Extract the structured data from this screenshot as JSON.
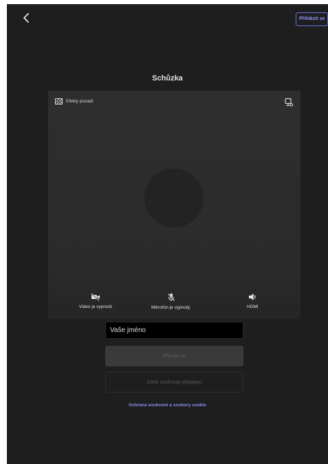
{
  "header": {
    "back_icon": "chevron-left-icon",
    "signin_label": "Přihlásit se"
  },
  "meeting": {
    "title": "Schůzka"
  },
  "preview": {
    "background_effects_label": "Efekty pozadí",
    "background_effects_icon": "background-effects-icon",
    "device_icon": "device-settings-icon",
    "controls": {
      "video": {
        "label": "Video je vypnuté",
        "icon": "video-off-icon"
      },
      "mic": {
        "label": "Mikrofon je vypnutý.",
        "icon": "mic-off-icon"
      },
      "speaker": {
        "label": "HDMI",
        "icon": "speaker-icon"
      }
    }
  },
  "form": {
    "name_placeholder": "Vaše jméno",
    "join_label": "Připojit se",
    "more_options_label": "Další možnosti připojení",
    "privacy_link": "Ochrana soukromí a soubory cookie"
  },
  "colors": {
    "background": "#1e1e1e",
    "preview": "#2e2e2e",
    "accent": "#8a8fff"
  }
}
